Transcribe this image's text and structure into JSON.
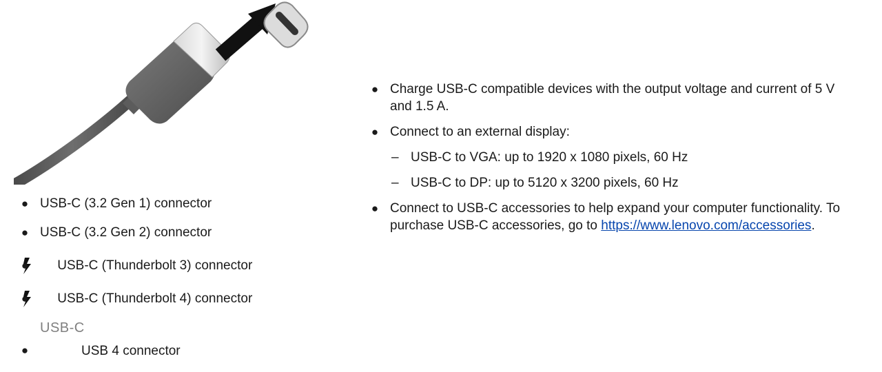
{
  "left_list": {
    "items": [
      {
        "label": "USB-C (3.2 Gen 1) connector"
      },
      {
        "label": "USB-C (3.2 Gen 2) connector"
      },
      {
        "label": "USB-C (Thunderbolt 3) connector",
        "icon": "thunderbolt-icon"
      },
      {
        "label": "USB-C (Thunderbolt 4) connector",
        "icon": "thunderbolt-icon"
      }
    ],
    "usb4": {
      "logo_text": "USB-C",
      "label": "USB 4 connector"
    }
  },
  "right_list": {
    "charge": "Charge USB-C compatible devices with the output voltage and current of 5 V and 1.5 A.",
    "display": "Connect to an external display:",
    "display_options": [
      "USB-C to VGA: up to 1920 x 1080 pixels, 60 Hz",
      "USB-C to DP: up to 5120 x 3200 pixels, 60 Hz"
    ],
    "accessories_text": "Connect to USB-C accessories to help expand your computer functionality. To purchase USB-C accessories, go to ",
    "accessories_link": "https://www.lenovo.com/accessories",
    "accessories_end": "."
  },
  "colors": {
    "cable": "#5a5a5a",
    "arrow": "#111111",
    "link": "#0645ad",
    "logo": "#808080"
  }
}
